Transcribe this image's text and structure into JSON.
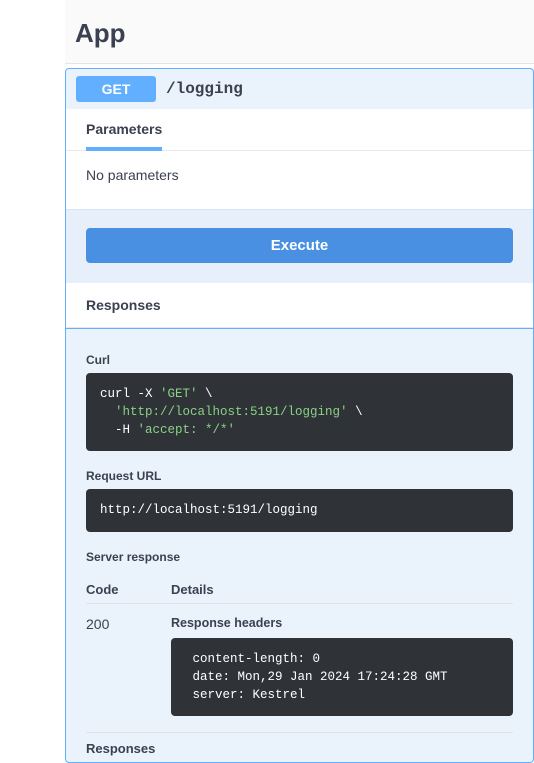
{
  "header": {
    "title": "App"
  },
  "operation": {
    "method": "GET",
    "path": "/logging"
  },
  "tabs": {
    "parameters": "Parameters"
  },
  "params": {
    "empty_text": "No parameters"
  },
  "buttons": {
    "execute": "Execute"
  },
  "sections": {
    "responses_title": "Responses",
    "curl_label": "Curl",
    "request_url_label": "Request URL",
    "server_response_label": "Server response",
    "code_col": "Code",
    "details_col": "Details",
    "response_headers_label": "Response headers",
    "responses_footer": "Responses"
  },
  "curl": {
    "line1_a": "curl -X ",
    "line1_b": "'GET'",
    "line1_c": " \\",
    "line2_a": "  ",
    "line2_b": "'http://localhost:5191/logging'",
    "line2_c": " \\",
    "line3_a": "  -H ",
    "line3_b": "'accept: */*'"
  },
  "request_url": "http://localhost:5191/logging",
  "response": {
    "status_code": "200",
    "headers_text": " content-length: 0 \n date: Mon,29 Jan 2024 17:24:28 GMT \n server: Kestrel "
  }
}
